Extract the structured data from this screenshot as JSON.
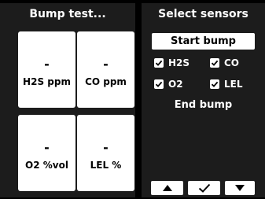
{
  "left_panel": {
    "title": "Bump test...",
    "tiles": [
      {
        "value": "-",
        "label": "H2S ppm"
      },
      {
        "value": "-",
        "label": "CO ppm"
      },
      {
        "value": "-",
        "label": "O2 %vol"
      },
      {
        "value": "-",
        "label": "LEL %"
      }
    ]
  },
  "right_panel": {
    "title": "Select sensors",
    "start_button": "Start bump",
    "sensors": [
      {
        "label": "H2S",
        "checked": true
      },
      {
        "label": "CO",
        "checked": true
      },
      {
        "label": "O2",
        "checked": true
      },
      {
        "label": "LEL",
        "checked": true
      }
    ],
    "end_label": "End bump",
    "nav": {
      "up_icon": "up-arrow-icon",
      "ok_icon": "checkmark-icon",
      "down_icon": "down-arrow-icon"
    }
  },
  "colors": {
    "background": "#000000",
    "panel": "#1c1c1c",
    "tile": "#ffffff",
    "text_light": "#ffffff",
    "text_dark": "#000000"
  }
}
